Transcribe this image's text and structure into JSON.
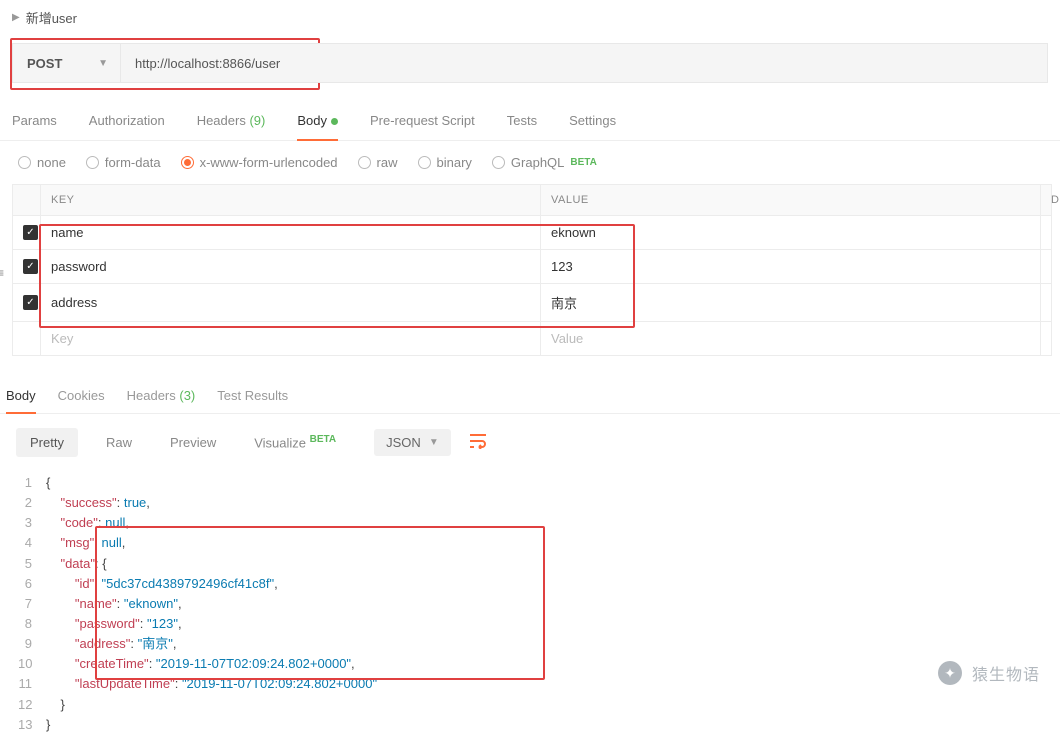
{
  "request": {
    "name": "新增user",
    "method": "POST",
    "url": "http://localhost:8866/user"
  },
  "tabs": {
    "params": "Params",
    "auth": "Authorization",
    "headers_label": "Headers",
    "headers_count": "(9)",
    "body": "Body",
    "prereq": "Pre-request Script",
    "tests": "Tests",
    "settings": "Settings"
  },
  "bodyTypes": {
    "none": "none",
    "formdata": "form-data",
    "urlencoded": "x-www-form-urlencoded",
    "raw": "raw",
    "binary": "binary",
    "graphql": "GraphQL",
    "beta": "BETA"
  },
  "kv": {
    "headers": {
      "key": "KEY",
      "value": "VALUE",
      "desc": "D"
    },
    "rows": [
      {
        "key": "name",
        "value": "eknown"
      },
      {
        "key": "password",
        "value": "123"
      },
      {
        "key": "address",
        "value": "南京"
      }
    ],
    "placeholder": {
      "key": "Key",
      "value": "Value"
    }
  },
  "respTabs": {
    "body": "Body",
    "cookies": "Cookies",
    "headers_label": "Headers",
    "headers_count": "(3)",
    "tests": "Test Results"
  },
  "format": {
    "pretty": "Pretty",
    "raw": "Raw",
    "preview": "Preview",
    "visualize": "Visualize",
    "beta": "BETA",
    "json": "JSON"
  },
  "response": {
    "lines": [
      {
        "n": "1",
        "indent": 0,
        "t": [
          {
            "c": "p",
            "v": "{"
          }
        ]
      },
      {
        "n": "2",
        "indent": 1,
        "t": [
          {
            "c": "k",
            "v": "\"success\""
          },
          {
            "c": "p",
            "v": ": "
          },
          {
            "c": "b",
            "v": "true"
          },
          {
            "c": "p",
            "v": ","
          }
        ]
      },
      {
        "n": "3",
        "indent": 1,
        "t": [
          {
            "c": "k",
            "v": "\"code\""
          },
          {
            "c": "p",
            "v": ": "
          },
          {
            "c": "n",
            "v": "null"
          },
          {
            "c": "p",
            "v": ","
          }
        ]
      },
      {
        "n": "4",
        "indent": 1,
        "t": [
          {
            "c": "k",
            "v": "\"msg\""
          },
          {
            "c": "p",
            "v": ": "
          },
          {
            "c": "n",
            "v": "null"
          },
          {
            "c": "p",
            "v": ","
          }
        ]
      },
      {
        "n": "5",
        "indent": 1,
        "t": [
          {
            "c": "k",
            "v": "\"data\""
          },
          {
            "c": "p",
            "v": ": {"
          }
        ]
      },
      {
        "n": "6",
        "indent": 2,
        "t": [
          {
            "c": "k",
            "v": "\"id\""
          },
          {
            "c": "p",
            "v": ": "
          },
          {
            "c": "s",
            "v": "\"5dc37cd4389792496cf41c8f\""
          },
          {
            "c": "p",
            "v": ","
          }
        ]
      },
      {
        "n": "7",
        "indent": 2,
        "t": [
          {
            "c": "k",
            "v": "\"name\""
          },
          {
            "c": "p",
            "v": ": "
          },
          {
            "c": "s",
            "v": "\"eknown\""
          },
          {
            "c": "p",
            "v": ","
          }
        ]
      },
      {
        "n": "8",
        "indent": 2,
        "t": [
          {
            "c": "k",
            "v": "\"password\""
          },
          {
            "c": "p",
            "v": ": "
          },
          {
            "c": "s",
            "v": "\"123\""
          },
          {
            "c": "p",
            "v": ","
          }
        ]
      },
      {
        "n": "9",
        "indent": 2,
        "t": [
          {
            "c": "k",
            "v": "\"address\""
          },
          {
            "c": "p",
            "v": ": "
          },
          {
            "c": "s",
            "v": "\"南京\""
          },
          {
            "c": "p",
            "v": ","
          }
        ]
      },
      {
        "n": "10",
        "indent": 2,
        "t": [
          {
            "c": "k",
            "v": "\"createTime\""
          },
          {
            "c": "p",
            "v": ": "
          },
          {
            "c": "s",
            "v": "\"2019-11-07T02:09:24.802+0000\""
          },
          {
            "c": "p",
            "v": ","
          }
        ]
      },
      {
        "n": "11",
        "indent": 2,
        "t": [
          {
            "c": "k",
            "v": "\"lastUpdateTime\""
          },
          {
            "c": "p",
            "v": ": "
          },
          {
            "c": "s",
            "v": "\"2019-11-07T02:09:24.802+0000\""
          }
        ]
      },
      {
        "n": "12",
        "indent": 1,
        "t": [
          {
            "c": "p",
            "v": "}"
          }
        ]
      },
      {
        "n": "13",
        "indent": 0,
        "t": [
          {
            "c": "p",
            "v": "}"
          }
        ]
      }
    ]
  },
  "watermark": "猿生物语"
}
